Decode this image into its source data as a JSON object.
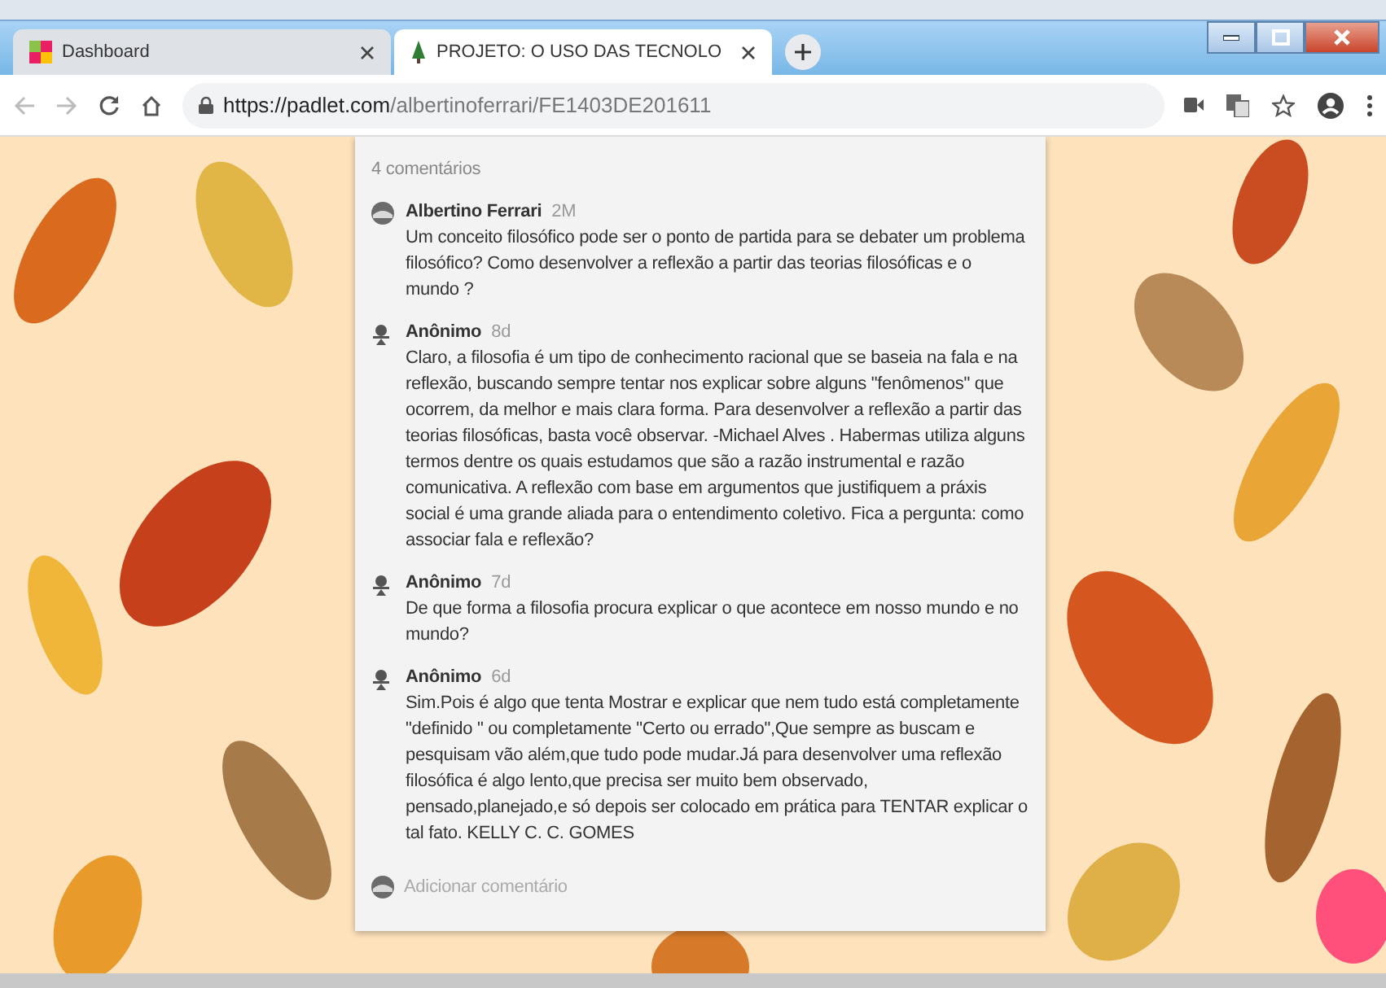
{
  "browser": {
    "tabs": [
      {
        "title": "Dashboard",
        "selected": false
      },
      {
        "title": "PROJETO: O USO DAS TECNOLO",
        "selected": true
      }
    ],
    "url": {
      "host": "https://padlet.com",
      "path": "/albertinoferrari/FE1403DE201611"
    }
  },
  "comments": {
    "count": "4 comentários",
    "items": [
      {
        "author": "Albertino Ferrari",
        "kind": "author",
        "time": "2M",
        "text": "Um conceito filosófico pode ser o ponto de partida para se debater um problema filosófico? Como desenvolver a reflexão a partir das teorias filosóficas e o mundo ?"
      },
      {
        "author": "Anônimo",
        "kind": "anonymous",
        "time": "8d",
        "text": "Claro, a filosofia é um tipo de conhecimento racional que se baseia na fala e na reflexão, buscando sempre tentar nos explicar sobre alguns \"fenômenos\" que ocorrem, da melhor e mais clara forma. Para desenvolver a reflexão a partir das teorias filosóficas, basta você observar. -Michael Alves . Habermas utiliza alguns termos dentre os quais estudamos que são a razão instrumental e razão comunicativa. A reflexão com base em argumentos que justifiquem a práxis social é uma grande aliada para o entendimento coletivo. Fica a pergunta: como associar fala e reflexão?"
      },
      {
        "author": "Anônimo",
        "kind": "anonymous",
        "time": "7d",
        "text": "De que forma a filosofia procura explicar o que acontece em nosso mundo e no mundo?"
      },
      {
        "author": "Anônimo",
        "kind": "anonymous",
        "time": "6d",
        "text": "Sim.Pois é algo que tenta Mostrar e explicar que nem tudo está completamente \"definido \" ou completamente \"Certo ou errado\",Que sempre as buscam e pesquisam vão além,que tudo pode mudar.Já para desenvolver uma reflexão filosófica é algo lento,que precisa ser muito bem observado, pensado,planejado,e só depois ser colocado em prática para TENTAR explicar o tal fato. KELLY C. C. GOMES"
      }
    ],
    "add_placeholder": "Adicionar comentário"
  }
}
